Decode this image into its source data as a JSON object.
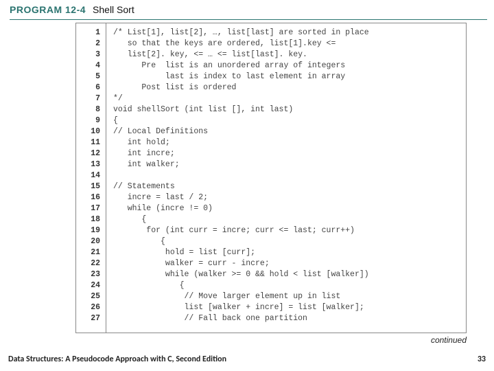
{
  "header": {
    "program_label": "PROGRAM 12-4",
    "program_title": "Shell Sort"
  },
  "code": {
    "lines": [
      {
        "n": "1",
        "t": "/* List[1], list[2], …, list[last] are sorted in place"
      },
      {
        "n": "2",
        "t": "   so that the keys are ordered, list[1].key <="
      },
      {
        "n": "3",
        "t": "   list[2]. key, <= … <= list[last]. key."
      },
      {
        "n": "4",
        "t": "      Pre  list is an unordered array of integers"
      },
      {
        "n": "5",
        "t": "           last is index to last element in array"
      },
      {
        "n": "6",
        "t": "      Post list is ordered"
      },
      {
        "n": "7",
        "t": "*/"
      },
      {
        "n": "8",
        "t": "void shellSort (int list [], int last)"
      },
      {
        "n": "9",
        "t": "{"
      },
      {
        "n": "10",
        "t": "// Local Definitions"
      },
      {
        "n": "11",
        "t": "   int hold;"
      },
      {
        "n": "12",
        "t": "   int incre;"
      },
      {
        "n": "13",
        "t": "   int walker;"
      },
      {
        "n": "14",
        "t": ""
      },
      {
        "n": "15",
        "t": "// Statements"
      },
      {
        "n": "16",
        "t": "   incre = last / 2;"
      },
      {
        "n": "17",
        "t": "   while (incre != 0)"
      },
      {
        "n": "18",
        "t": "      {"
      },
      {
        "n": "19",
        "t": "       for (int curr = incre; curr <= last; curr++)"
      },
      {
        "n": "20",
        "t": "          {"
      },
      {
        "n": "21",
        "t": "           hold = list [curr];"
      },
      {
        "n": "22",
        "t": "           walker = curr - incre;"
      },
      {
        "n": "23",
        "t": "           while (walker >= 0 && hold < list [walker])"
      },
      {
        "n": "24",
        "t": "              {"
      },
      {
        "n": "25",
        "t": "               // Move larger element up in list"
      },
      {
        "n": "26",
        "t": "               list [walker + incre] = list [walker];"
      },
      {
        "n": "27",
        "t": "               // Fall back one partition"
      }
    ]
  },
  "continued_label": "continued",
  "footer": {
    "left": "Data Structures: A Pseudocode Approach with C, Second Edition",
    "right": "33"
  }
}
